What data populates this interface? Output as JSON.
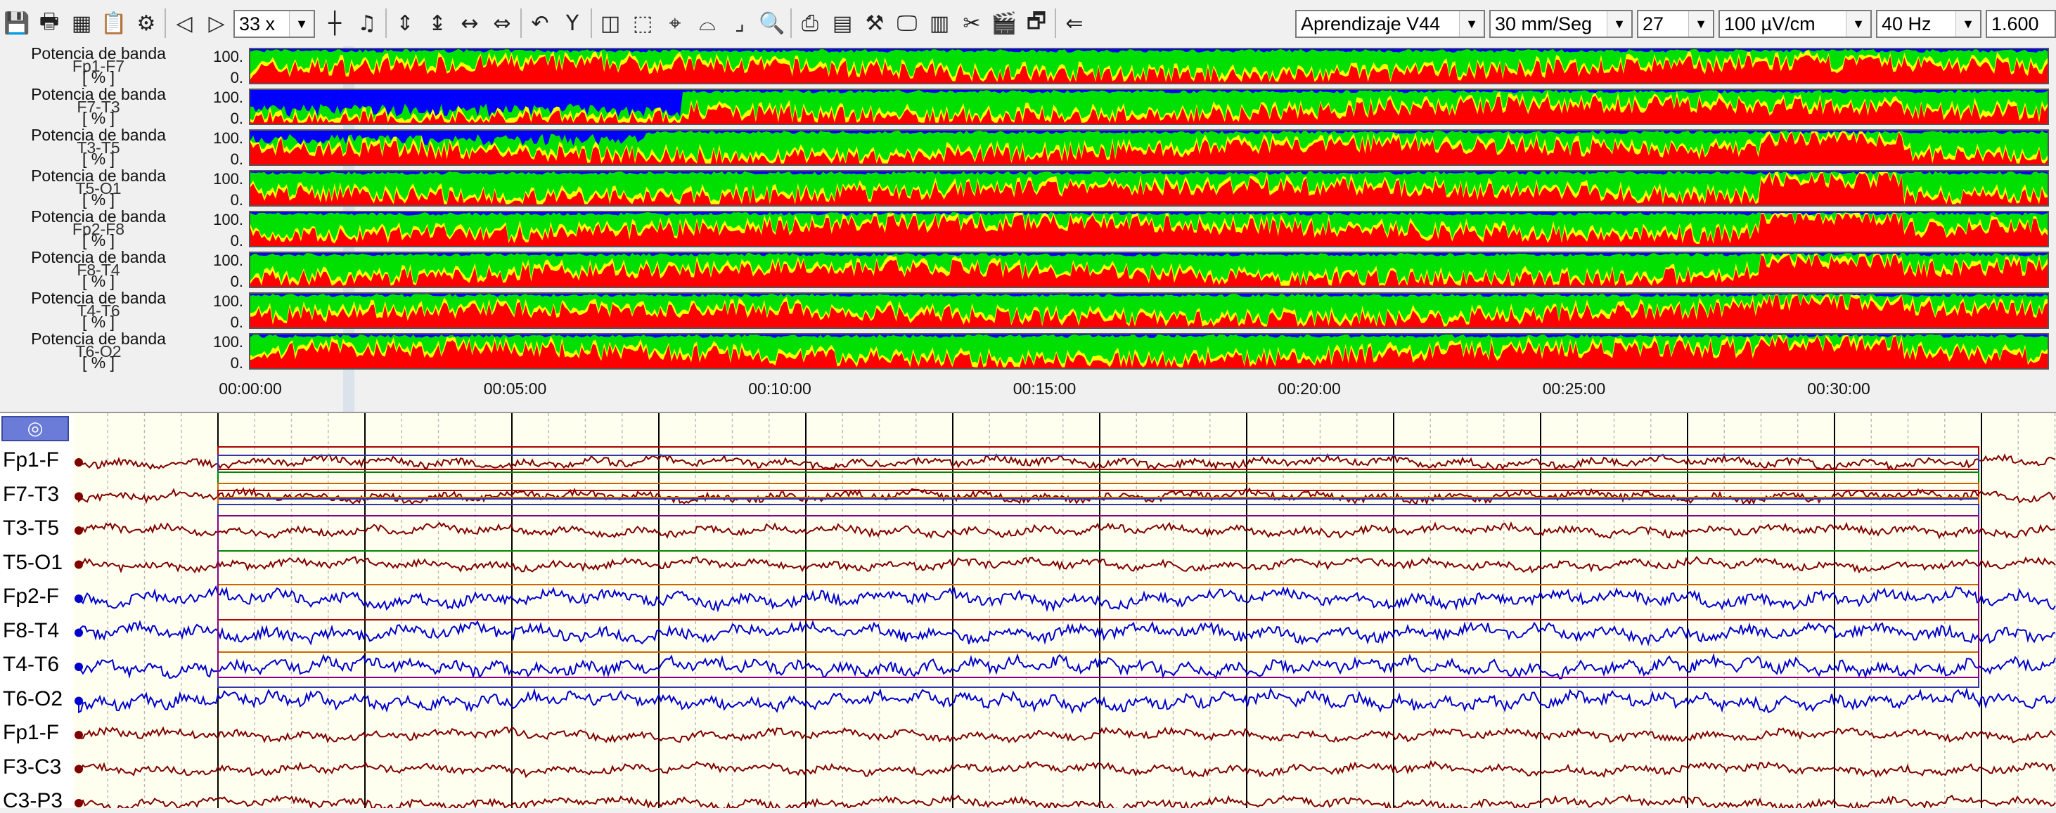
{
  "toolbar": {
    "buttons": [
      {
        "name": "save-icon",
        "glyph": "💾"
      },
      {
        "name": "print-icon",
        "glyph": "🖶"
      },
      {
        "name": "grid-icon",
        "glyph": "▦"
      },
      {
        "name": "clipboard-icon",
        "glyph": "📋"
      },
      {
        "name": "brain-icon",
        "glyph": "⚙"
      },
      {
        "name": "prev-page-icon",
        "glyph": "◁"
      },
      {
        "name": "next-page-icon",
        "glyph": "▷"
      }
    ],
    "zoom": "33 x",
    "tools_left": [
      {
        "name": "line-icon",
        "glyph": "┼"
      },
      {
        "name": "music-icon",
        "glyph": "♫"
      },
      {
        "name": "vscale-icon",
        "glyph": "⇕"
      },
      {
        "name": "vmark-icon",
        "glyph": "↨"
      },
      {
        "name": "hmark-icon",
        "glyph": "↔"
      },
      {
        "name": "hscale-icon",
        "glyph": "⇔"
      },
      {
        "name": "undo-icon",
        "glyph": "↶"
      },
      {
        "name": "filter-icon",
        "glyph": "Y"
      }
    ],
    "tools_right": [
      {
        "name": "select-icon",
        "glyph": "◫"
      },
      {
        "name": "marquee-icon",
        "glyph": "⬚"
      },
      {
        "name": "target-icon",
        "glyph": "⌖"
      },
      {
        "name": "bridge-icon",
        "glyph": "⌓"
      },
      {
        "name": "corner-icon",
        "glyph": "⌟"
      },
      {
        "name": "magnifier-icon",
        "glyph": "🔍"
      },
      {
        "name": "printer2-icon",
        "glyph": "⎙"
      },
      {
        "name": "layout-icon",
        "glyph": "▤"
      },
      {
        "name": "tools-icon",
        "glyph": "⚒"
      },
      {
        "name": "monitor-icon",
        "glyph": "🖵"
      },
      {
        "name": "calculator-icon",
        "glyph": "▥"
      },
      {
        "name": "scissors-icon",
        "glyph": "✂"
      },
      {
        "name": "clapper-icon",
        "glyph": "🎬"
      },
      {
        "name": "window-icon",
        "glyph": "🗗"
      },
      {
        "name": "back-arrow-icon",
        "glyph": "⇐"
      }
    ],
    "montage": "Aprendizaje V44",
    "speed": "30 mm/Seg",
    "channels": "27",
    "sensitivity": "100 µV/cm",
    "filter": "40 Hz",
    "extra": "1.600"
  },
  "trend": {
    "label_line1": "Potencia de banda",
    "label_unit": "[ % ]",
    "ymax": "100.",
    "ymin": "0.",
    "channels": [
      "Fp1-F7",
      "F7-T3",
      "T3-T5",
      "T5-O1",
      "Fp2-F8",
      "F8-T4",
      "T4-T6",
      "T6-O2"
    ],
    "time_ticks": [
      "00:00:00",
      "00:05:00",
      "00:10:00",
      "00:15:00",
      "00:20:00",
      "00:25:00",
      "00:30:00"
    ],
    "colors": {
      "delta": "#ff0000",
      "theta": "#ffff00",
      "alpha": "#00e000",
      "beta": "#0000ff"
    }
  },
  "eeg": {
    "eye_glyph": "◎",
    "channels": [
      {
        "label": "Fp1-F",
        "color": "#800000"
      },
      {
        "label": "F7-T3",
        "color": "#800000"
      },
      {
        "label": "T3-T5",
        "color": "#800000"
      },
      {
        "label": "T5-O1",
        "color": "#800000"
      },
      {
        "label": "Fp2-F",
        "color": "#0000cc"
      },
      {
        "label": "F8-T4",
        "color": "#0000cc"
      },
      {
        "label": "T4-T6",
        "color": "#0000cc"
      },
      {
        "label": "T6-O2",
        "color": "#0000cc"
      },
      {
        "label": "Fp1-F",
        "color": "#800000"
      },
      {
        "label": "F3-C3",
        "color": "#800000"
      },
      {
        "label": "C3-P3",
        "color": "#800000"
      }
    ]
  }
}
